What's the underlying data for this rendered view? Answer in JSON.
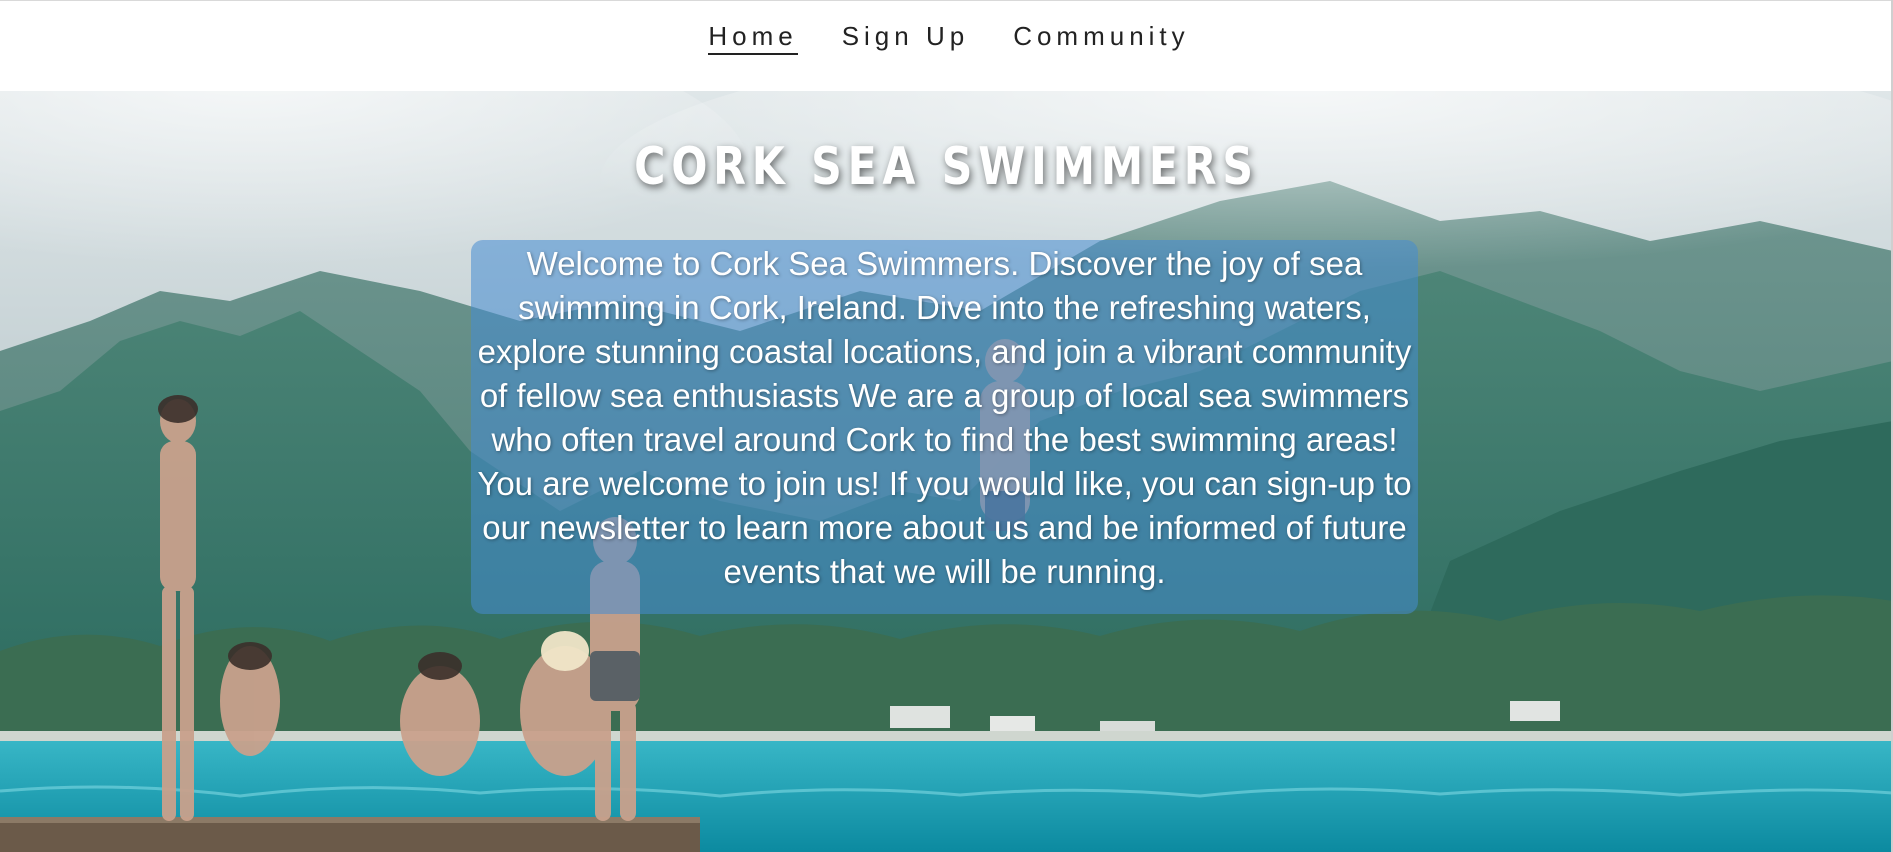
{
  "nav": {
    "links": [
      {
        "label": "Home",
        "active": true
      },
      {
        "label": "Sign Up",
        "active": false
      },
      {
        "label": "Community",
        "active": false
      }
    ]
  },
  "hero": {
    "title": "CORK SEA SWIMMERS",
    "intro": "Welcome to Cork Sea Swimmers. Discover the joy of sea swimming in Cork, Ireland. Dive into the refreshing waters, explore stunning coastal locations, and join a vibrant community of fellow sea enthusiasts We are a group of local sea swimmers who often travel around Cork to find the best swimming areas! You are welcome to join us! If you would like, you can sign-up to our newsletter to learn more about us and be informed of future events that we will be running."
  },
  "colors": {
    "nav_text": "#222222",
    "intro_box": "rgba(70, 140, 210, 0.55)",
    "sea": "#1aa3b8"
  }
}
